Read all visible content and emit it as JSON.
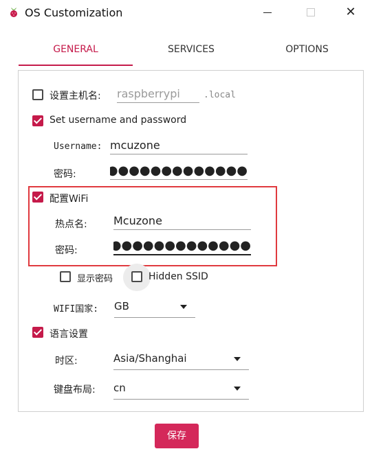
{
  "window": {
    "title": "OS Customization",
    "close_glyph": "✕"
  },
  "tabs": [
    {
      "label": "GENERAL",
      "active": true
    },
    {
      "label": "SERVICES",
      "active": false
    },
    {
      "label": "OPTIONS",
      "active": false
    }
  ],
  "general": {
    "hostname": {
      "label": "设置主机名:",
      "checked": false,
      "placeholder": "raspberrypi",
      "suffix": ".local"
    },
    "user": {
      "label": "Set username and password",
      "checked": true,
      "username_label": "Username:",
      "username_value": "mcuzone",
      "password_label": "密码:",
      "password_dots": "●●●●●●●●●●●●●"
    },
    "wifi": {
      "label": "配置WiFi",
      "checked": true,
      "ssid_label": "热点名:",
      "ssid_value": "Mcuzone",
      "password_label": "密码:",
      "password_dots": "●●●●●●●●●●●●●●",
      "show_password_label": "显示密码",
      "show_password_checked": false,
      "hidden_ssid_label": "Hidden SSID",
      "hidden_ssid_checked": false,
      "country_label": "WIFI国家:",
      "country_value": "GB"
    },
    "locale": {
      "label": "语言设置",
      "checked": true,
      "timezone_label": "时区:",
      "timezone_value": "Asia/Shanghai",
      "keyboard_label": "键盘布局:",
      "keyboard_value": "cn"
    }
  },
  "footer": {
    "save_label": "保存"
  },
  "colors": {
    "accent": "#c51a4a",
    "annotation": "#e0393e"
  },
  "icons": {
    "app": "raspberry-icon"
  }
}
